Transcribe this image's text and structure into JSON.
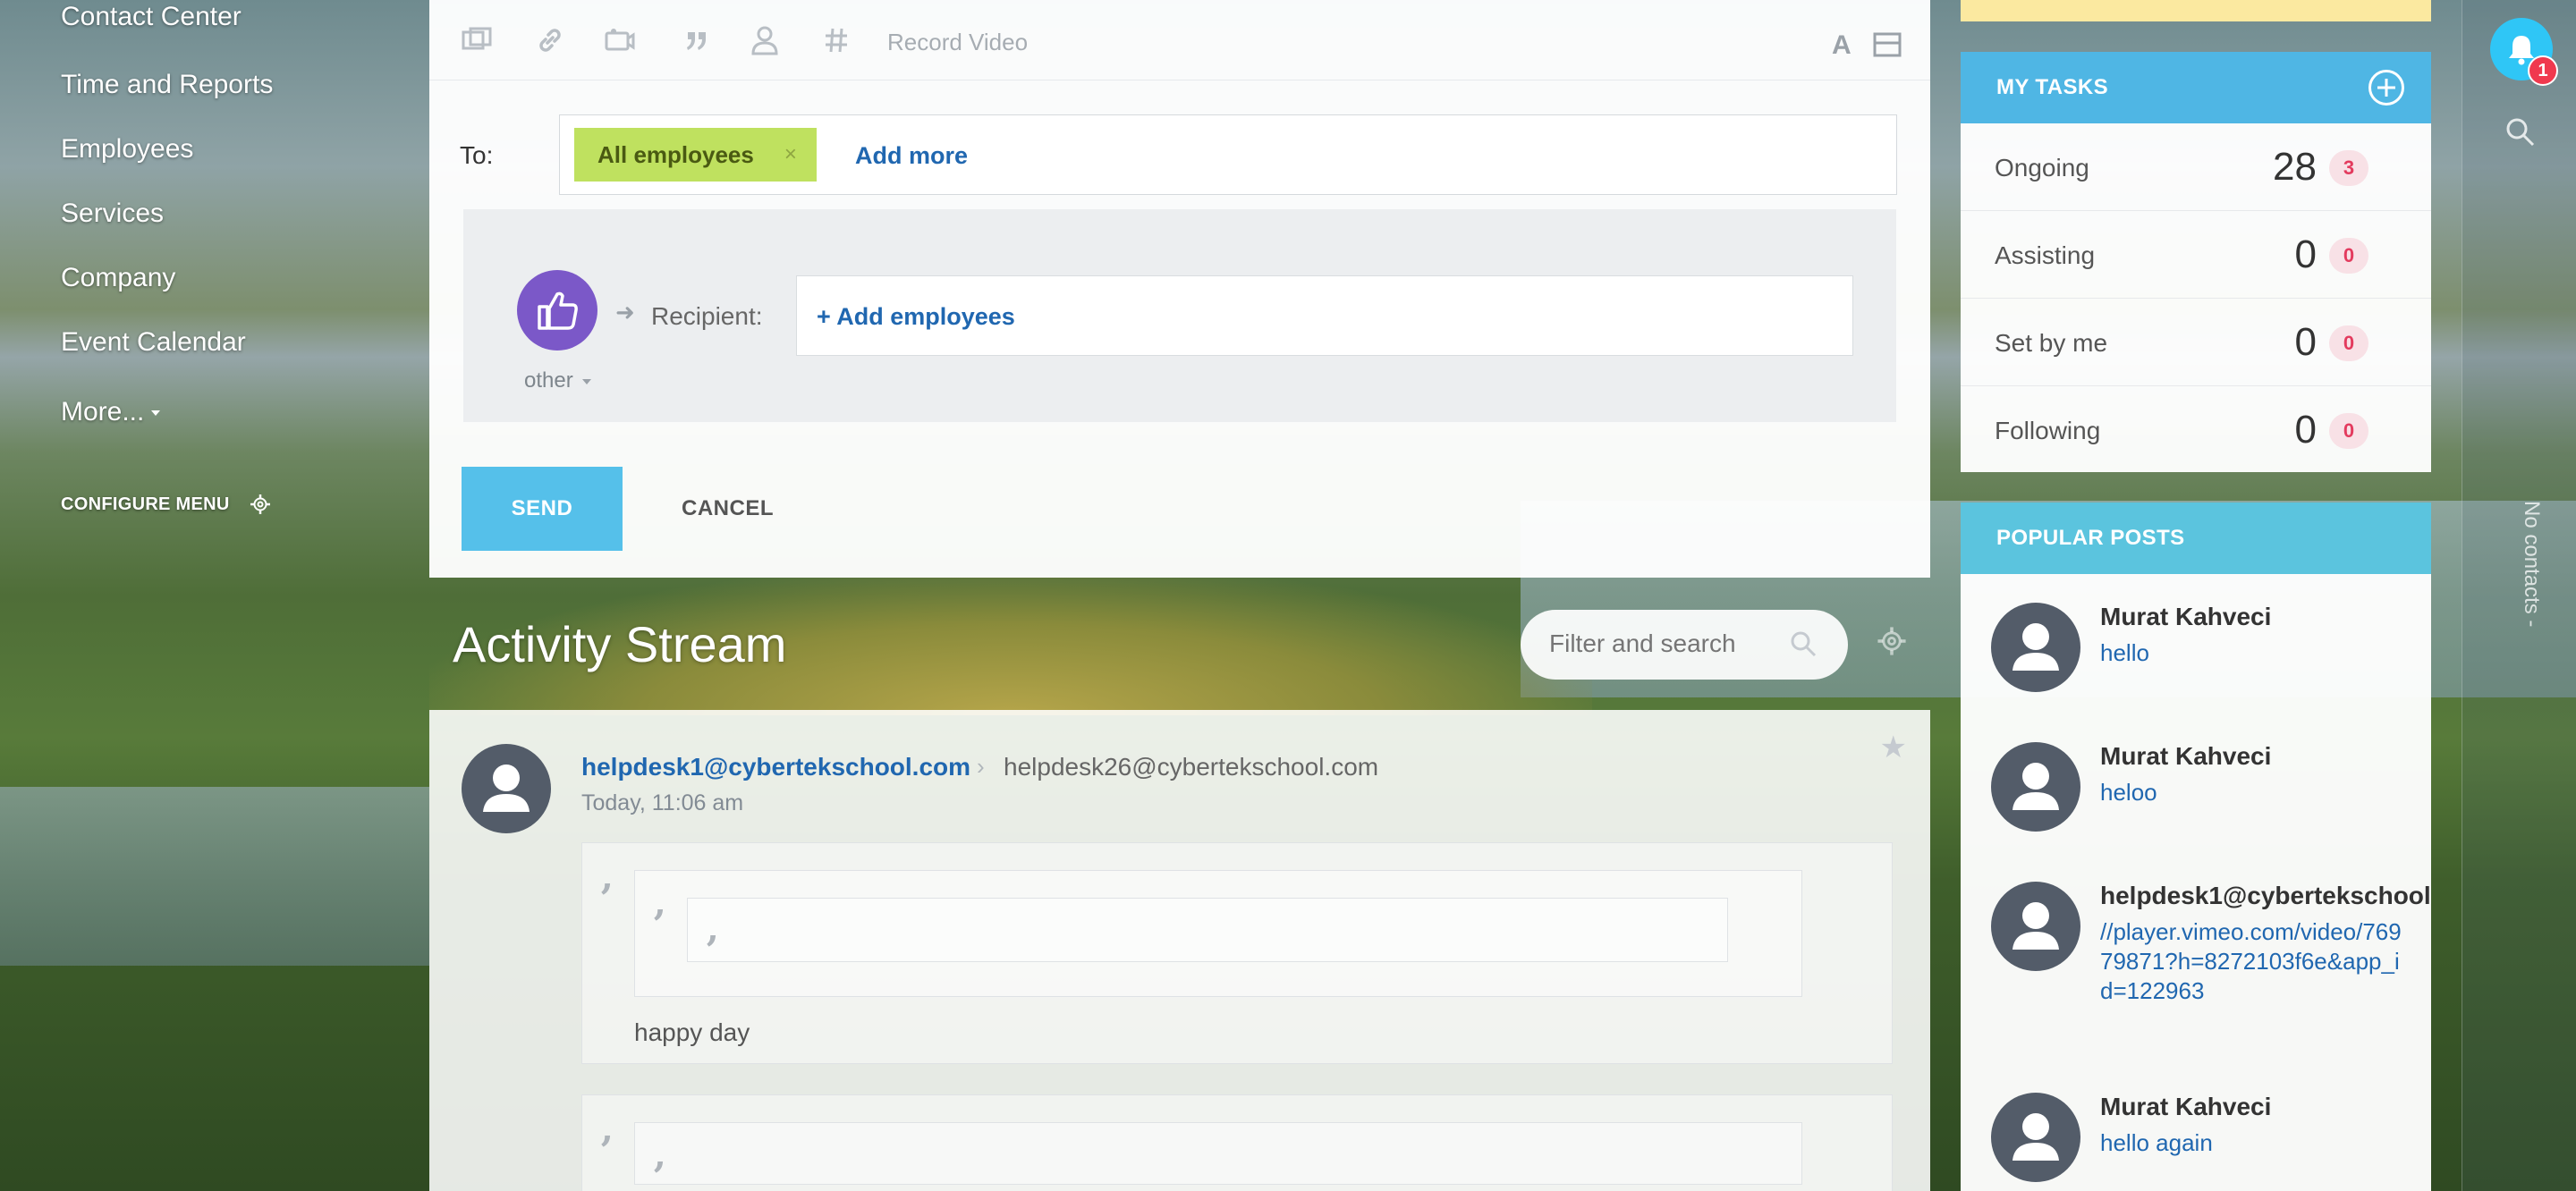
{
  "nav": {
    "items": [
      {
        "label": "Contact Center"
      },
      {
        "label": "Time and Reports"
      },
      {
        "label": "Employees"
      },
      {
        "label": "Services"
      },
      {
        "label": "Company"
      },
      {
        "label": "Event Calendar"
      },
      {
        "label": "More..."
      }
    ],
    "configure_label": "CONFIGURE MENU"
  },
  "composer": {
    "toolbar": {
      "icons": [
        "file-icon",
        "link-icon",
        "video-icon",
        "quote-icon",
        "user-mention-icon",
        "hashtag-icon"
      ],
      "record_video": "Record Video",
      "text_format": "A"
    },
    "to_label": "To:",
    "recipient_chip": "All employees",
    "chip_remove": "×",
    "add_more": "Add more",
    "gratitude": {
      "type_label": "other",
      "recipient_label": "Recipient:",
      "add_employees": "+ Add employees"
    },
    "send_label": "SEND",
    "cancel_label": "CANCEL"
  },
  "stream": {
    "title": "Activity Stream",
    "filter_placeholder": "Filter and search"
  },
  "post": {
    "author": "helpdesk1@cybertekschool.com",
    "recipient": "helpdesk26@cybertekschool.com",
    "time": "Today, 11:06 am",
    "quote_text": "happy day"
  },
  "tasks": {
    "title": "MY TASKS",
    "rows": [
      {
        "label": "Ongoing",
        "count": "28",
        "badge": "3"
      },
      {
        "label": "Assisting",
        "count": "0",
        "badge": "0"
      },
      {
        "label": "Set by me",
        "count": "0",
        "badge": "0"
      },
      {
        "label": "Following",
        "count": "0",
        "badge": "0"
      }
    ]
  },
  "popular": {
    "title": "POPULAR POSTS",
    "posts": [
      {
        "name": "Murat Kahveci",
        "text": "hello"
      },
      {
        "name": "Murat Kahveci",
        "text": "heloo"
      },
      {
        "name": "helpdesk1@cybertekschool.",
        "text": "//player.vimeo.com/video/76979871?h=8272103f6e&app_id=122963"
      },
      {
        "name": "Murat Kahveci",
        "text": "hello again"
      }
    ]
  },
  "sidebar": {
    "notification_count": "1",
    "no_contacts": "No contacts -"
  },
  "colors": {
    "accent": "#2fc6f6",
    "link": "#2067b0",
    "send_button": "#55c0ea",
    "chip": "#bfe15f",
    "badge_text": "#e33b5e"
  }
}
